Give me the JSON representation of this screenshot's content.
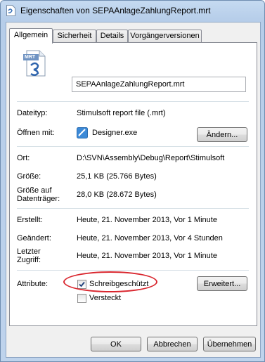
{
  "window": {
    "title": "Eigenschaften von SEPAAnlageZahlungReport.mrt"
  },
  "tabs": [
    {
      "label": "Allgemein",
      "active": true
    },
    {
      "label": "Sicherheit",
      "active": false
    },
    {
      "label": "Details",
      "active": false
    },
    {
      "label": "Vorgängerversionen",
      "active": false
    }
  ],
  "file": {
    "icon_text": "MRT",
    "name": "SEPAAnlageZahlungReport.mrt"
  },
  "type": {
    "label": "Dateityp:",
    "value": "Stimulsoft report file (.mrt)"
  },
  "opens_with": {
    "label": "Öffnen mit:",
    "value": "Designer.exe",
    "change_button": "Ändern..."
  },
  "location": {
    "label": "Ort:",
    "value": "D:\\SVN\\Assembly\\Debug\\Report\\Stimulsoft"
  },
  "size": {
    "label": "Größe:",
    "value": "25,1 KB (25.766 Bytes)"
  },
  "size_on_disk": {
    "label_line1": "Größe auf",
    "label_line2": "Datenträger:",
    "value": "28,0 KB (28.672 Bytes)"
  },
  "created": {
    "label": "Erstellt:",
    "value": "Heute, 21. November 2013, Vor 1 Minute"
  },
  "modified": {
    "label": "Geändert:",
    "value": "Heute, 21. November 2013, Vor 4 Stunden"
  },
  "accessed": {
    "label_line1": "Letzter",
    "label_line2": "Zugriff:",
    "value": "Heute, 21. November 2013, Vor 1 Minute"
  },
  "attributes": {
    "label": "Attribute:",
    "readonly": {
      "label": "Schreibgeschützt",
      "checked": true
    },
    "hidden": {
      "label": "Versteckt",
      "checked": false
    },
    "advanced_button": "Erweitert..."
  },
  "buttons": {
    "ok": "OK",
    "cancel": "Abbrechen",
    "apply": "Übernehmen"
  },
  "colors": {
    "highlight_ellipse": "#d9262e",
    "window_frame": "#bed3ec"
  }
}
